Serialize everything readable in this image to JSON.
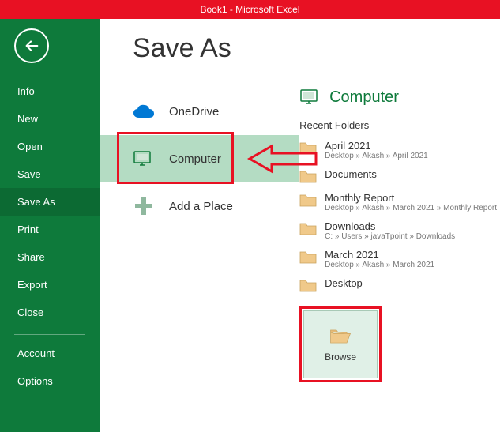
{
  "titlebar": {
    "text": "Book1 -  Microsoft Excel"
  },
  "sidebar": {
    "items": [
      {
        "label": "Info"
      },
      {
        "label": "New"
      },
      {
        "label": "Open"
      },
      {
        "label": "Save"
      },
      {
        "label": "Save As"
      },
      {
        "label": "Print"
      },
      {
        "label": "Share"
      },
      {
        "label": "Export"
      },
      {
        "label": "Close"
      }
    ],
    "footer": [
      {
        "label": "Account"
      },
      {
        "label": "Options"
      }
    ]
  },
  "page": {
    "heading": "Save As",
    "places": {
      "onedrive": "OneDrive",
      "computer": "Computer",
      "addplace": "Add a Place"
    },
    "right": {
      "header": "Computer",
      "recent_label": "Recent Folders",
      "folders": [
        {
          "name": "April 2021",
          "path": "Desktop » Akash » April 2021"
        },
        {
          "name": "Documents",
          "path": ""
        },
        {
          "name": "Monthly Report",
          "path": "Desktop » Akash » March 2021 » Monthly Report"
        },
        {
          "name": "Downloads",
          "path": "C: » Users » javaTpoint » Downloads"
        },
        {
          "name": "March 2021",
          "path": "Desktop » Akash » March 2021"
        },
        {
          "name": "Desktop",
          "path": ""
        }
      ],
      "browse_label": "Browse"
    }
  },
  "annotation": {
    "arrow_color": "#e81123"
  }
}
